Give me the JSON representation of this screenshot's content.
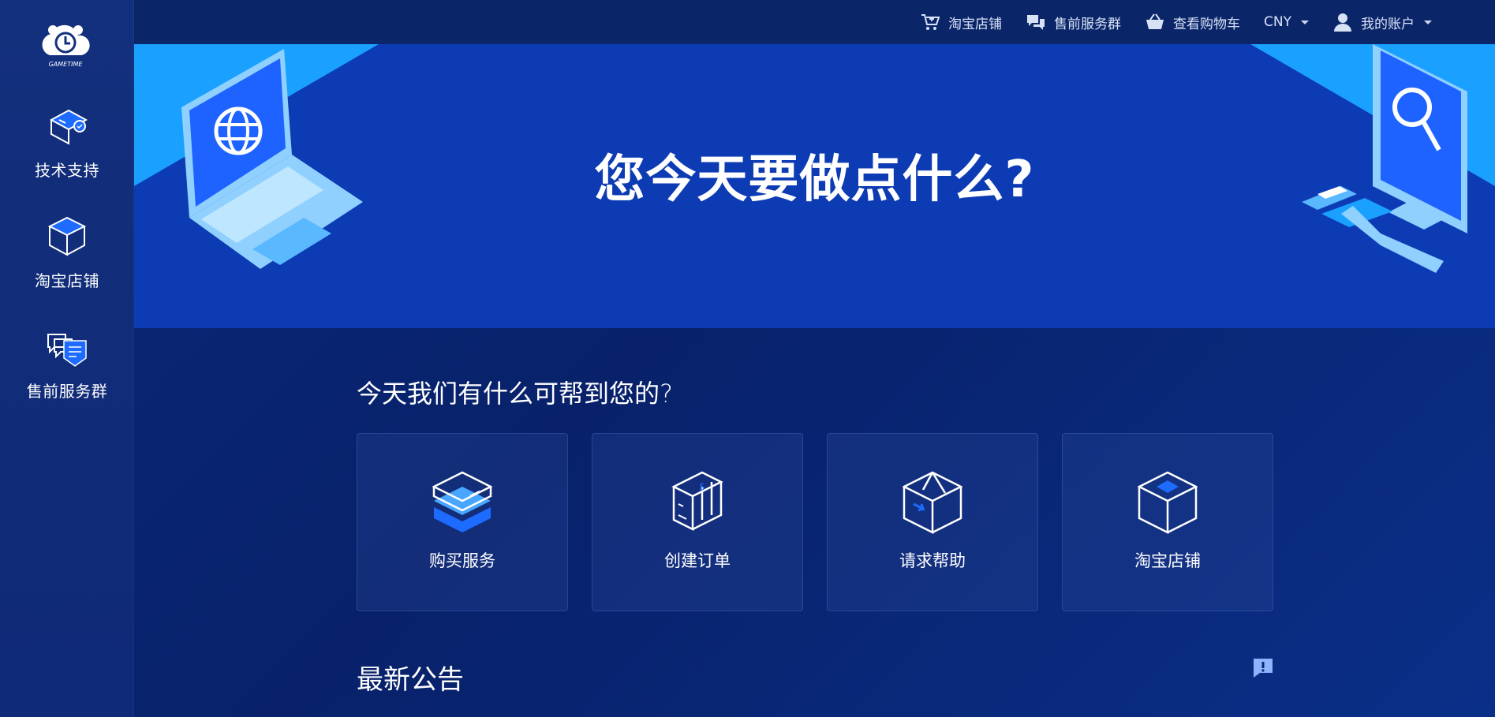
{
  "brand": {
    "logo_text": "GAMETIME"
  },
  "sidebar": {
    "items": [
      {
        "label": "技术支持",
        "icon": "tech-support-icon"
      },
      {
        "label": "淘宝店铺",
        "icon": "box-icon"
      },
      {
        "label": "售前服务群",
        "icon": "chat-group-icon"
      }
    ]
  },
  "topbar": {
    "items": [
      {
        "label": "淘宝店铺",
        "icon": "cart-plus-icon"
      },
      {
        "label": "售前服务群",
        "icon": "comments-icon"
      },
      {
        "label": "查看购物车",
        "icon": "basket-icon"
      }
    ],
    "currency": "CNY",
    "account": "我的账户"
  },
  "hero": {
    "title": "您今天要做点什么?"
  },
  "main": {
    "help_title": "今天我们有什么可帮到您的?",
    "cards": [
      {
        "label": "购买服务",
        "icon": "buy-service-icon"
      },
      {
        "label": "创建订单",
        "icon": "create-order-icon"
      },
      {
        "label": "请求帮助",
        "icon": "request-help-icon"
      },
      {
        "label": "淘宝店铺",
        "icon": "taobao-store-icon"
      }
    ],
    "news_title": "最新公告"
  },
  "colors": {
    "background": "#0a2670",
    "hero": "#0c3bb4",
    "accent": "#1e6bff",
    "light_blue": "#8fd0ff"
  }
}
